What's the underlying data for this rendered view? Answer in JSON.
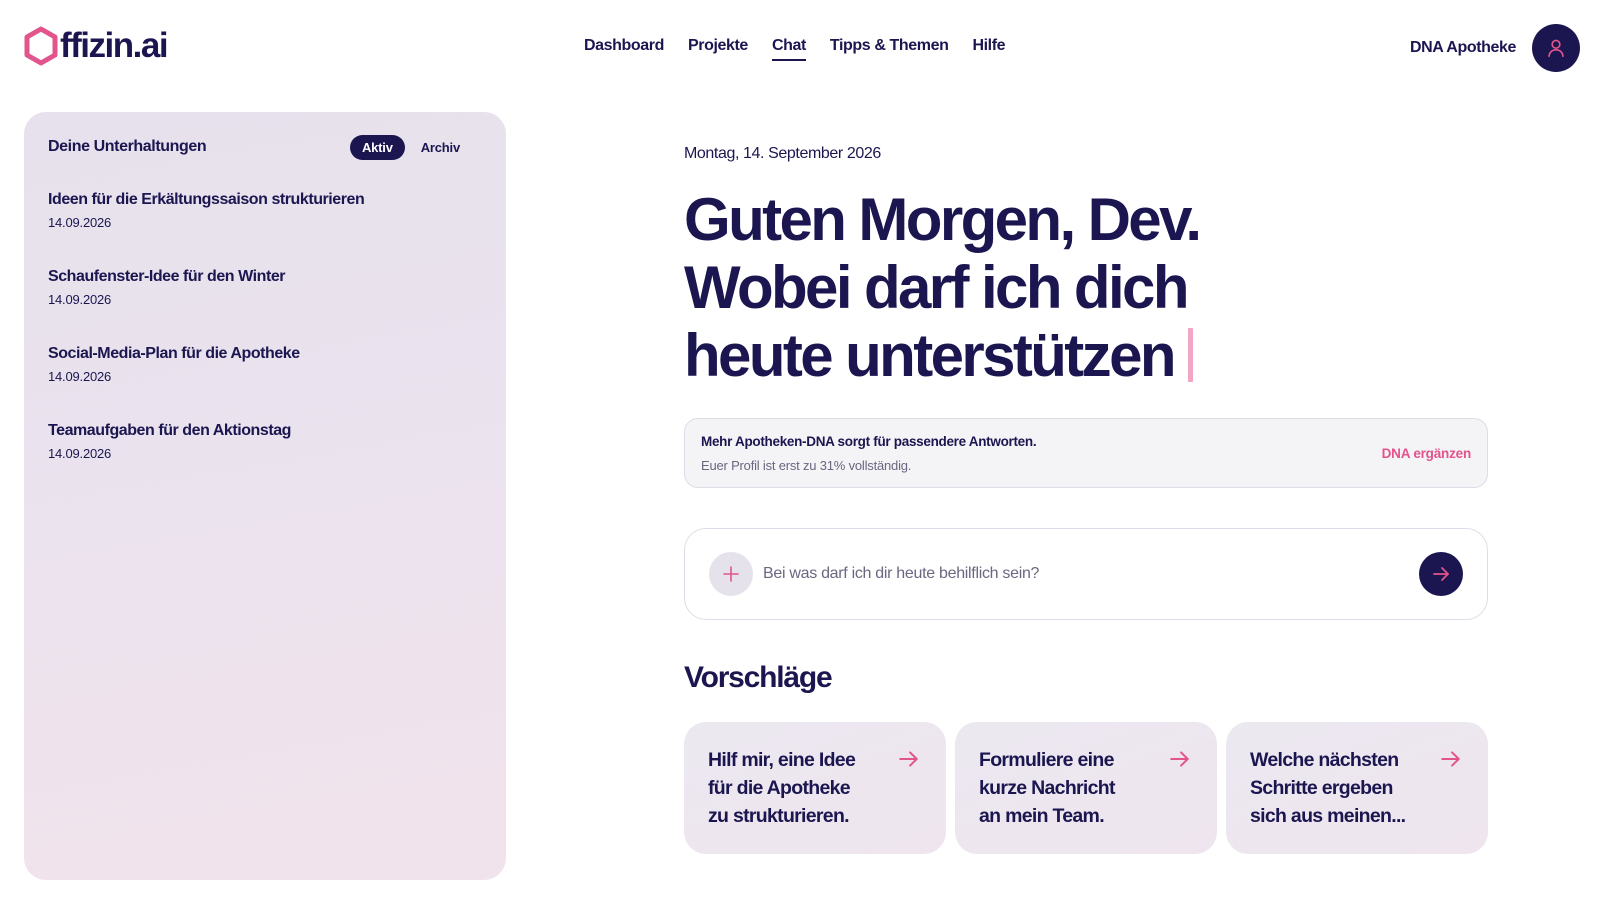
{
  "brand": {
    "logo_text": "ffizin.ai",
    "logo_color": "#e2548c",
    "primary_color": "#1b1650",
    "accent_color": "#e2548c"
  },
  "nav": {
    "items": [
      {
        "label": "Dashboard",
        "active": false
      },
      {
        "label": "Projekte",
        "active": false
      },
      {
        "label": "Chat",
        "active": true
      },
      {
        "label": "Tipps & Themen",
        "active": false
      },
      {
        "label": "Hilfe",
        "active": false
      }
    ]
  },
  "account": {
    "name": "DNA Apotheke",
    "avatar_icon": "user-icon"
  },
  "sidebar": {
    "title": "Deine Unterhaltungen",
    "toggle": {
      "active": "Aktiv",
      "archive": "Archiv"
    },
    "conversations": [
      {
        "title": "Ideen für die Erkältungssaison strukturieren",
        "date": "14.09.2026"
      },
      {
        "title": "Schaufenster-Idee für den Winter",
        "date": "14.09.2026"
      },
      {
        "title": "Social-Media-Plan für die Apotheke",
        "date": "14.09.2026"
      },
      {
        "title": "Teamaufgaben für den Aktionstag",
        "date": "14.09.2026"
      }
    ]
  },
  "main": {
    "date": "Montag, 14. September 2026",
    "headline": [
      "Guten Morgen, Dev.",
      "Wobei darf ich dich",
      "heute unterstützen"
    ],
    "dna_notice": {
      "title": "Mehr Apotheken-DNA sorgt für passendere Antworten.",
      "subtitle": "Euer Profil ist erst zu 31% vollständig.",
      "link": "DNA ergänzen"
    },
    "chat": {
      "placeholder": "Bei was darf ich dir heute behilflich sein?",
      "value": ""
    },
    "suggestions_heading": "Vorschläge",
    "suggestions": [
      {
        "lines": [
          "Hilf mir, eine Idee",
          "für die Apotheke",
          "zu strukturieren."
        ]
      },
      {
        "lines": [
          "Formuliere eine",
          "kurze Nachricht",
          "an mein Team."
        ]
      },
      {
        "lines": [
          "Welche nächsten",
          "Schritte ergeben",
          "sich aus meinen..."
        ]
      }
    ]
  }
}
